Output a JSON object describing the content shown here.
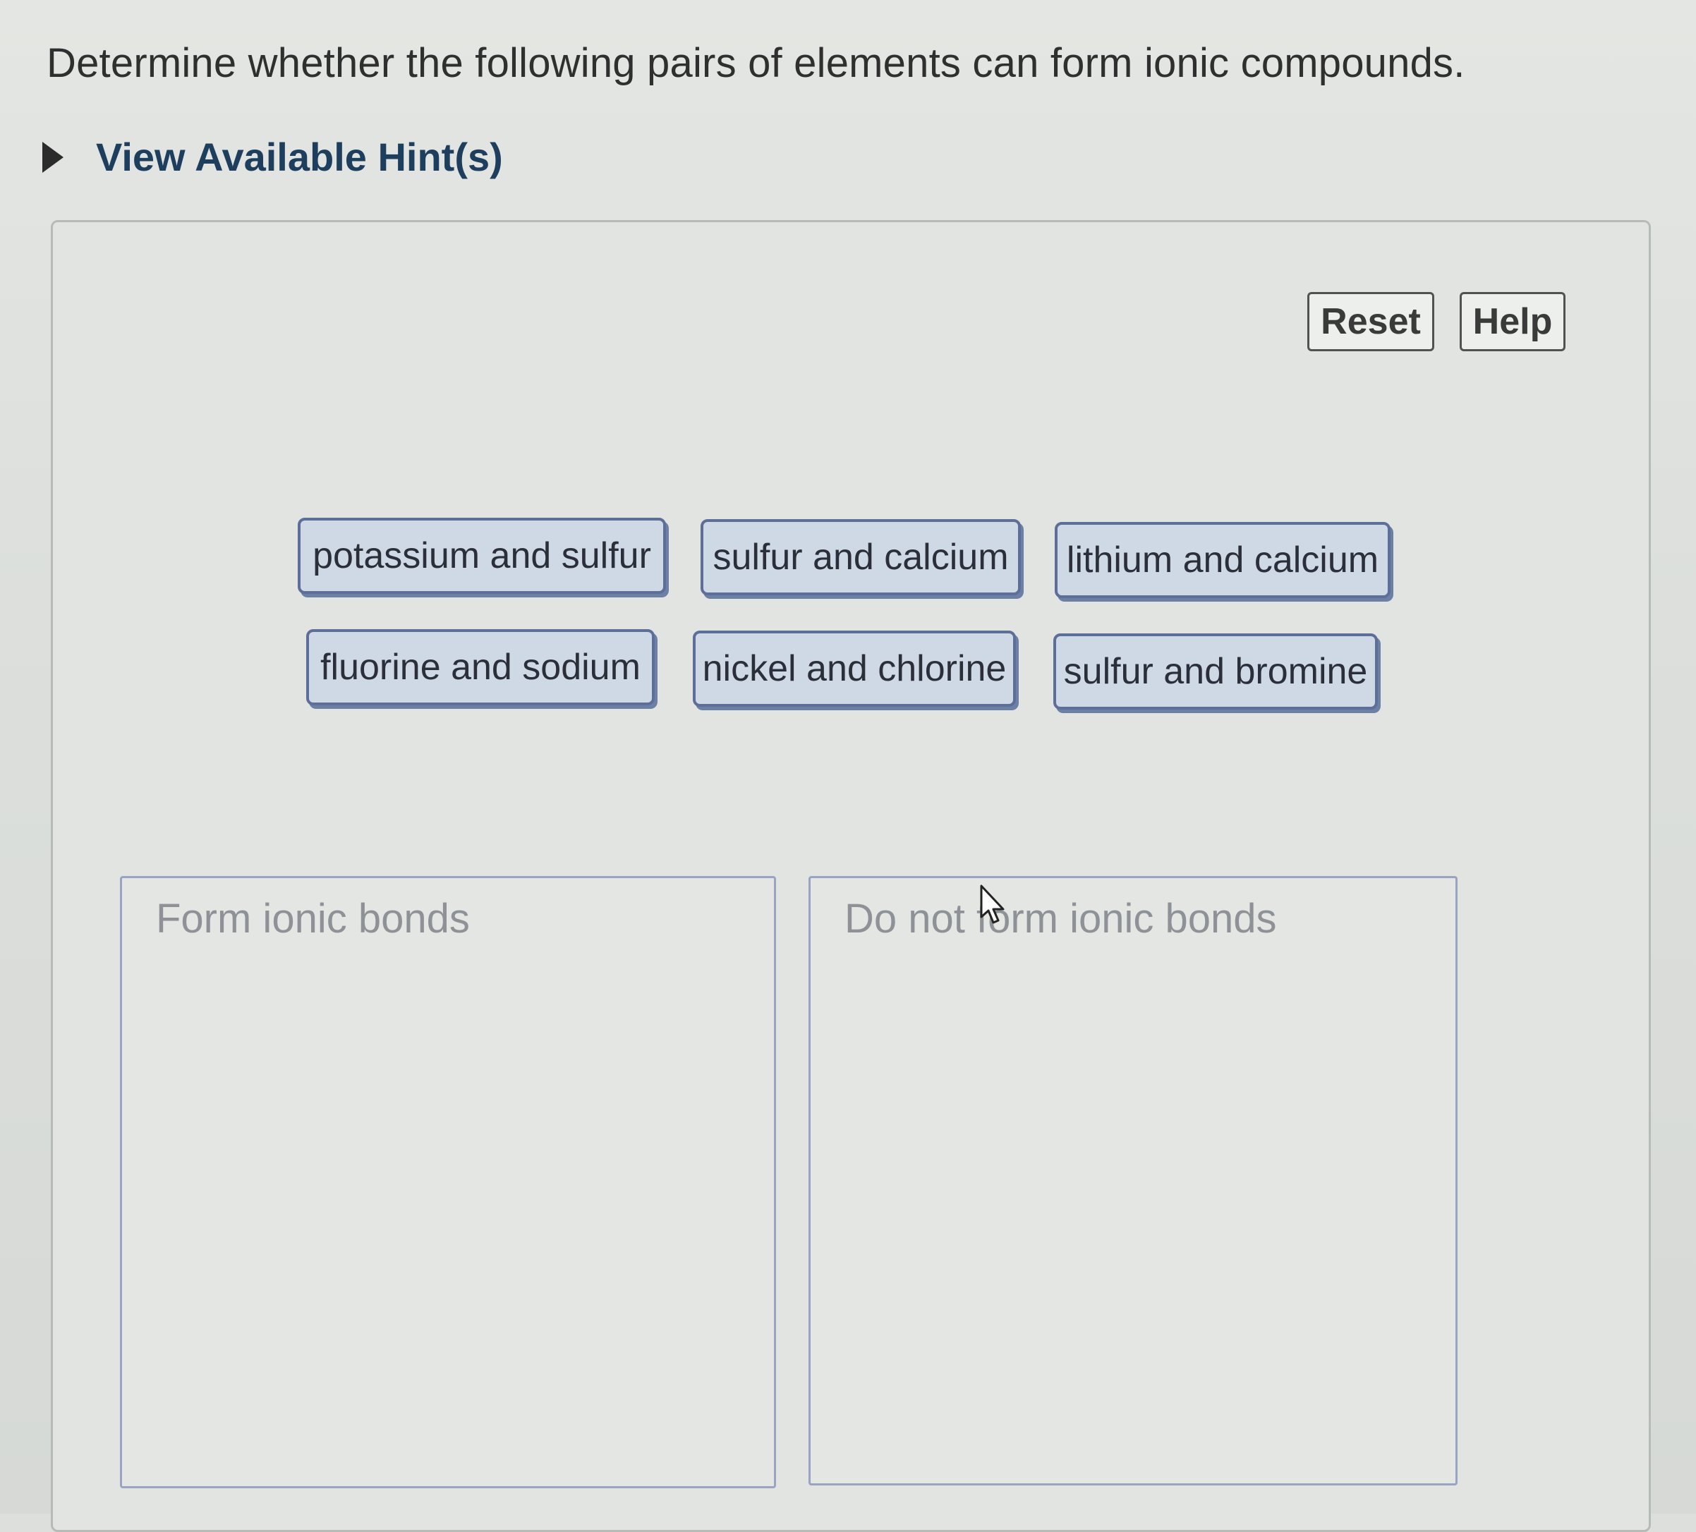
{
  "question": "Determine whether the following pairs of elements can form ionic compounds.",
  "hint": {
    "label": "View Available Hint(s)",
    "icon": "triangle-right-icon"
  },
  "toolbar": {
    "reset": "Reset",
    "help": "Help"
  },
  "chips": [
    "potassium and sulfur",
    "sulfur and calcium",
    "lithium and calcium",
    "fluorine and sodium",
    "nickel and chlorine",
    "sulfur and bromine"
  ],
  "dropzones": {
    "form": "Form ionic bonds",
    "do_not_form": "Do not form ionic bonds"
  },
  "colors": {
    "hint_text": "#1d3e5c",
    "chip_bg": "#cfd8e5",
    "chip_border": "#5d6f98",
    "dropzone_border": "#9aa4c2"
  }
}
